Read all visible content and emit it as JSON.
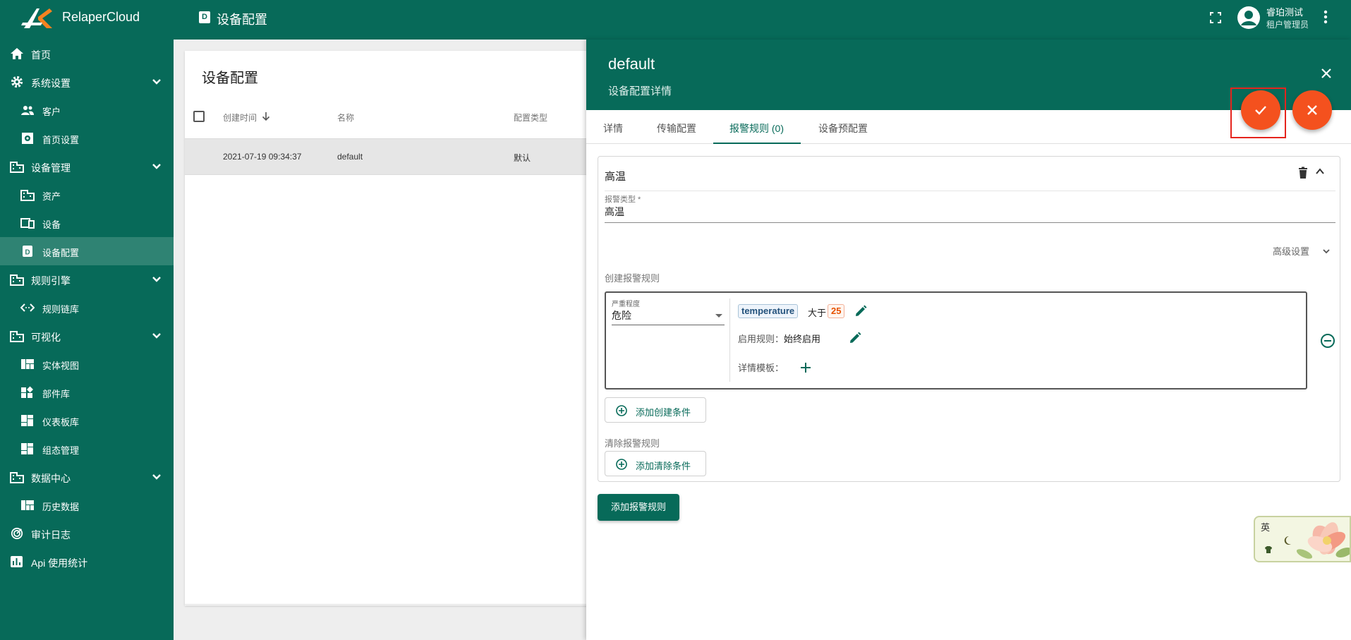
{
  "header": {
    "brand": "RelaperCloud",
    "page_icon_letter": "D",
    "page_title": "设备配置",
    "user_name": "睿珀测试",
    "user_role": "租户管理员"
  },
  "sidebar": {
    "items": [
      {
        "label": "首页",
        "icon": "home-icon",
        "level": 0
      },
      {
        "label": "系统设置",
        "icon": "gear-icon",
        "level": 0,
        "expandable": true
      },
      {
        "label": "客户",
        "icon": "people-icon",
        "level": 1
      },
      {
        "label": "首页设置",
        "icon": "settings-square-icon",
        "level": 1
      },
      {
        "label": "设备管理",
        "icon": "building-icon",
        "level": 0,
        "expandable": true
      },
      {
        "label": "资产",
        "icon": "building-icon",
        "level": 1
      },
      {
        "label": "设备",
        "icon": "devices-icon",
        "level": 1
      },
      {
        "label": "设备配置",
        "icon": "device-profile-icon",
        "level": 1,
        "active": true
      },
      {
        "label": "规则引擎",
        "icon": "building-icon",
        "level": 0,
        "expandable": true
      },
      {
        "label": "规则链库",
        "icon": "code-icon",
        "level": 1
      },
      {
        "label": "可视化",
        "icon": "building-icon",
        "level": 0,
        "expandable": true
      },
      {
        "label": "实体视图",
        "icon": "view-quilt-icon",
        "level": 1
      },
      {
        "label": "部件库",
        "icon": "widgets-icon",
        "level": 1
      },
      {
        "label": "仪表板库",
        "icon": "dashboard-icon",
        "level": 1
      },
      {
        "label": "组态管理",
        "icon": "dashboard-icon",
        "level": 1
      },
      {
        "label": "数据中心",
        "icon": "building-icon",
        "level": 0,
        "expandable": true
      },
      {
        "label": "历史数据",
        "icon": "view-quilt-icon",
        "level": 1
      },
      {
        "label": "审计日志",
        "icon": "track-changes-icon",
        "level": 0
      },
      {
        "label": "Api 使用统计",
        "icon": "bar-chart-icon",
        "level": 0
      }
    ]
  },
  "table": {
    "title": "设备配置",
    "columns": [
      "创建时间",
      "名称",
      "配置类型"
    ],
    "rows": [
      {
        "created": "2021-07-19 09:34:37",
        "name": "default",
        "type": "默认"
      }
    ]
  },
  "panel": {
    "title": "default",
    "subtitle": "设备配置详情",
    "tabs": [
      "详情",
      "传输配置",
      "报警规则 (0)",
      "设备预配置"
    ],
    "active_tab": 2,
    "alarm": {
      "name": "高温",
      "type_label": "报警类型 *",
      "type_value": "高温",
      "advanced": "高级设置",
      "create_rules_label": "创建报警规则",
      "severity_label": "严重程度",
      "severity_value": "危险",
      "condition_key": "temperature",
      "condition_op": "大于",
      "condition_value": "25",
      "schedule_label": "启用规则：:",
      "schedule_value": "始终启用",
      "details_label": "详情模板：",
      "add_create_condition": "添加创建条件",
      "clear_rules_label": "清除报警规则",
      "add_clear_condition": "添加清除条件"
    },
    "add_alarm_rule": "添加报警规则"
  },
  "widget": {
    "label": "英"
  },
  "colors": {
    "primary": "#076a59",
    "accent": "#f4511e",
    "highlight": "#e5241d"
  }
}
